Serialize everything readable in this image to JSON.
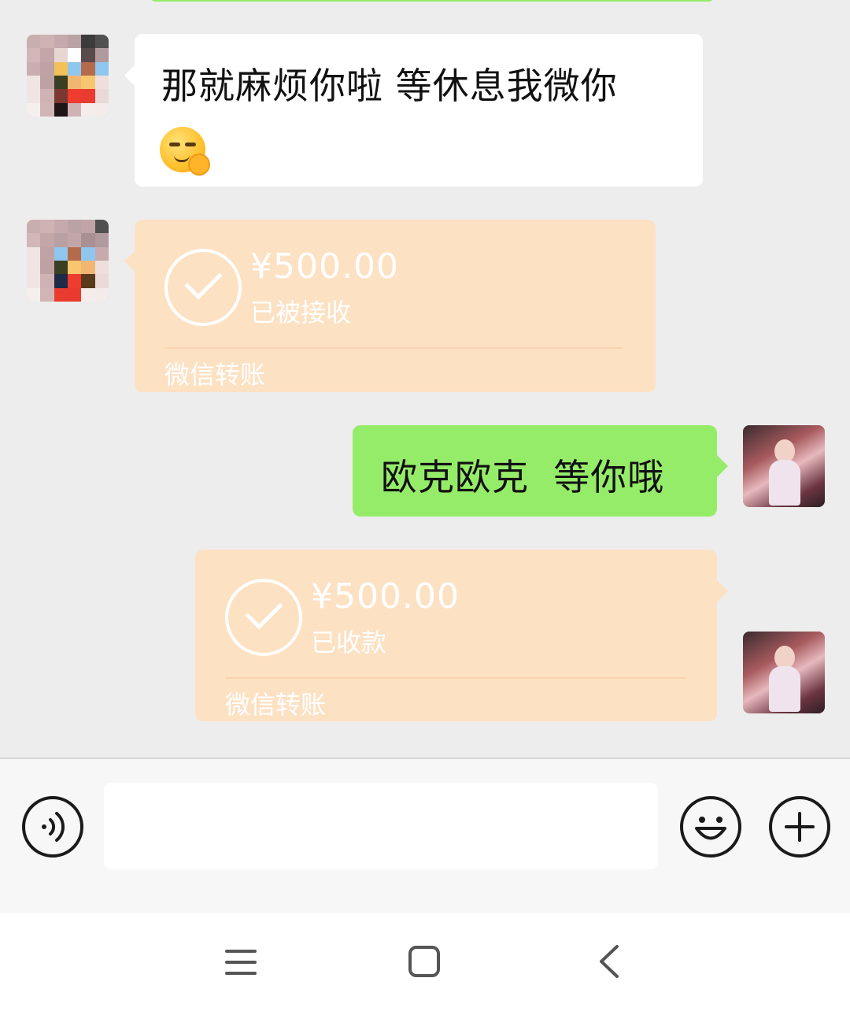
{
  "messages": [
    {
      "side": "left",
      "type": "text",
      "text": "那就麻烦你啦 等休息我微你",
      "emoji": "smirk-ok-hand-emoji"
    },
    {
      "side": "left",
      "type": "transfer",
      "amount": "¥500.00",
      "status": "已被接收",
      "label": "微信转账"
    },
    {
      "side": "right",
      "type": "text",
      "text": "欧克欧克  等你哦"
    },
    {
      "side": "right",
      "type": "transfer",
      "amount": "¥500.00",
      "status": "已收款",
      "label": "微信转账"
    }
  ],
  "input_bar": {
    "value": "",
    "placeholder": ""
  },
  "icons": {
    "voice": "voice-icon",
    "emoji": "smile-icon",
    "more": "plus-icon",
    "nav_menu": "menu-icon",
    "nav_home": "square-home-icon",
    "nav_back": "back-chevron-icon"
  },
  "colors": {
    "background": "#ededed",
    "received_bubble": "#ffffff",
    "sent_bubble": "#95ec69",
    "transfer_bubble": "#fde1c3",
    "transfer_text": "#ffffff"
  }
}
